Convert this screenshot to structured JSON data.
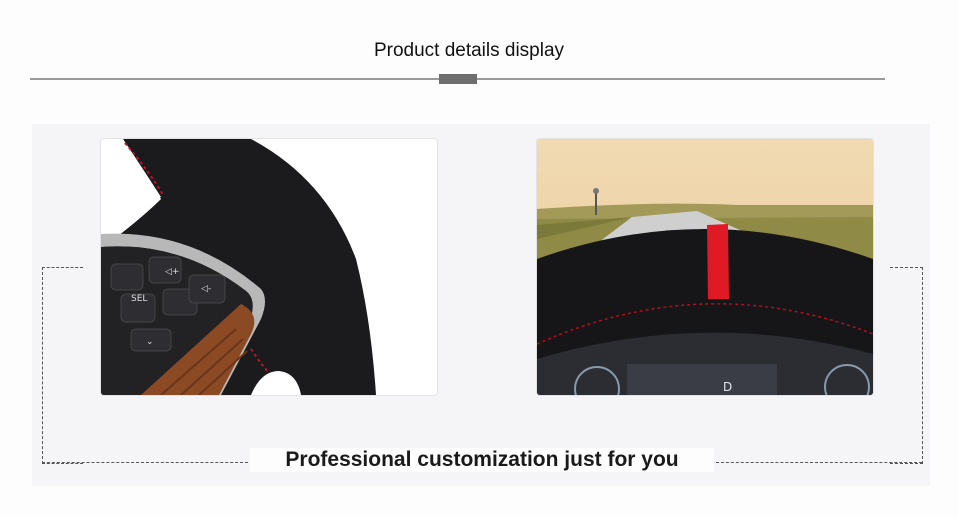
{
  "header": {
    "title": "Product details display"
  },
  "caption": {
    "text": "Professional customization just for you"
  },
  "photos": [
    {
      "name": "steering-wheel-controls-photo",
      "colors": {
        "suede": "#1b1b1d",
        "stitch": "#c0122a",
        "wood": "#8b4a24",
        "trim": "#b8b8b8"
      }
    },
    {
      "name": "steering-wheel-road-view-photo",
      "colors": {
        "sky": "#efd7ad",
        "grass": "#8f8a45",
        "suede": "#161618",
        "marker": "#e01a24"
      }
    }
  ],
  "colors": {
    "rule": "#9a9a9a",
    "rule_accent": "#6e6e6e",
    "panel": "#f5f5f7",
    "dash": "#555555"
  }
}
